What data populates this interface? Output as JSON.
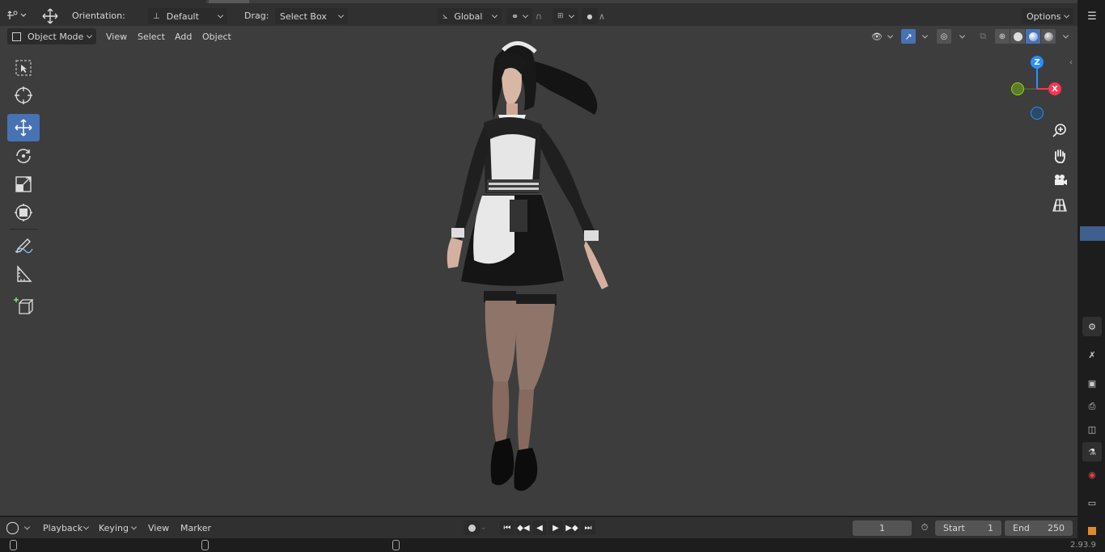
{
  "header": {
    "orientation_label": "Orientation:",
    "orientation_value": "Default",
    "drag_label": "Drag:",
    "drag_value": "Select Box",
    "transform_value": "Global",
    "options_label": "Options"
  },
  "viewport_header": {
    "mode": "Object Mode",
    "menus": [
      "View",
      "Select",
      "Add",
      "Object"
    ]
  },
  "gizmo": {
    "z": "Z",
    "x": "X"
  },
  "timeline": {
    "menus": [
      "Playback",
      "Keying",
      "View",
      "Marker"
    ],
    "current_frame": "1",
    "start_label": "Start",
    "start_value": "1",
    "end_label": "End",
    "end_value": "250"
  },
  "status": {
    "version": "2.93.9"
  },
  "colors": {
    "accent": "#4772b3",
    "viewport_bg": "#3d3d3d",
    "x_axis": "#ff3352",
    "y_axis": "#8bdc00",
    "z_axis": "#2890ff"
  },
  "icons": [
    "select-box-icon",
    "cursor-icon",
    "move-icon",
    "rotate-icon",
    "scale-icon",
    "transform-icon",
    "annotate-icon",
    "measure-icon",
    "add-cube-icon",
    "zoom-icon",
    "hand-icon",
    "camera-icon",
    "grid-view-icon"
  ]
}
